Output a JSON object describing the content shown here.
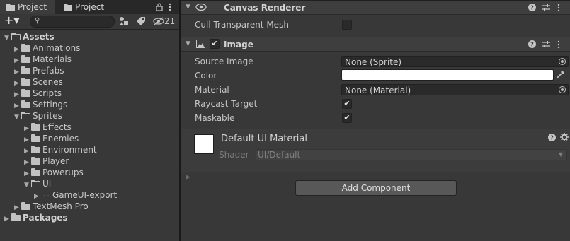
{
  "project_panel": {
    "tabs": [
      {
        "label": "Project"
      },
      {
        "label": "Project"
      }
    ],
    "tab_icons": {
      "lock": "lock-icon",
      "menu": "kebab-menu-icon"
    },
    "toolbar": {
      "add_label": "+▾",
      "search_placeholder": "",
      "hidden_count": "21"
    },
    "tree": [
      {
        "label": "Assets",
        "depth": 0,
        "expanded": true,
        "bold": true
      },
      {
        "label": "Animations",
        "depth": 1,
        "expanded": false
      },
      {
        "label": "Materials",
        "depth": 1,
        "expanded": false
      },
      {
        "label": "Prefabs",
        "depth": 1,
        "expanded": false
      },
      {
        "label": "Scenes",
        "depth": 1,
        "expanded": false
      },
      {
        "label": "Scripts",
        "depth": 1,
        "expanded": false
      },
      {
        "label": "Settings",
        "depth": 1,
        "expanded": false
      },
      {
        "label": "Sprites",
        "depth": 1,
        "expanded": true
      },
      {
        "label": "Effects",
        "depth": 2,
        "expanded": false
      },
      {
        "label": "Enemies",
        "depth": 2,
        "expanded": false
      },
      {
        "label": "Environment",
        "depth": 2,
        "expanded": false
      },
      {
        "label": "Player",
        "depth": 2,
        "expanded": false
      },
      {
        "label": "Powerups",
        "depth": 2,
        "expanded": false
      },
      {
        "label": "UI",
        "depth": 2,
        "expanded": true
      },
      {
        "label": "GameUI-export",
        "depth": 3,
        "expanded": false,
        "asset": true
      },
      {
        "label": "TextMesh Pro",
        "depth": 1,
        "expanded": false
      },
      {
        "label": "Packages",
        "depth": 0,
        "expanded": false,
        "bold": true
      }
    ]
  },
  "inspector": {
    "canvas_renderer": {
      "title": "Canvas Renderer",
      "cull_label": "Cull Transparent Mesh",
      "cull_checked": false
    },
    "image": {
      "title": "Image",
      "enabled": true,
      "source_image_label": "Source Image",
      "source_image_value": "None (Sprite)",
      "color_label": "Color",
      "color_value": "#ffffff",
      "material_label": "Material",
      "material_value": "None (Material)",
      "raycast_label": "Raycast Target",
      "raycast_checked": true,
      "maskable_label": "Maskable",
      "maskable_checked": true
    },
    "material": {
      "name": "Default UI Material",
      "shader_label": "Shader",
      "shader_value": "UI/Default"
    },
    "add_component_label": "Add Component"
  },
  "colors": {
    "panel_bg": "#383838",
    "header_bg": "#3e3e3e",
    "field_bg": "#2a2a2a",
    "button_bg": "#585858"
  }
}
